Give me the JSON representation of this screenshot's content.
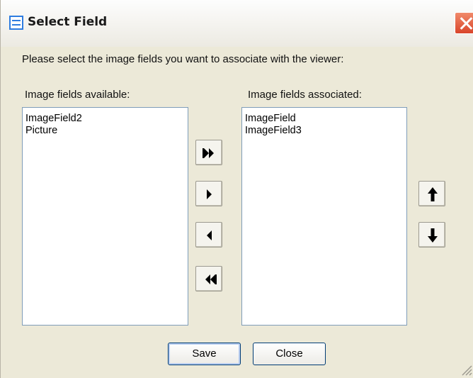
{
  "window": {
    "title": "Select Field"
  },
  "instructions": "Please select the image fields you want to associate with the viewer:",
  "available": {
    "label": "Image fields available:",
    "items": [
      "ImageField2",
      "Picture"
    ]
  },
  "associated": {
    "label": "Image fields associated:",
    "items": [
      "ImageField",
      "ImageField3"
    ]
  },
  "buttons": {
    "save": "Save",
    "close": "Close"
  },
  "icons": {
    "title": "window-icon",
    "close": "close-icon",
    "add_all": "double-arrow-right-icon",
    "add": "arrow-right-icon",
    "remove": "arrow-left-icon",
    "remove_all": "double-arrow-left-icon",
    "move_up": "arrow-up-icon",
    "move_down": "arrow-down-icon"
  },
  "colors": {
    "dialog_bg": "#ece9d8",
    "list_border": "#7f9db9",
    "close_red": "#d9452a"
  }
}
